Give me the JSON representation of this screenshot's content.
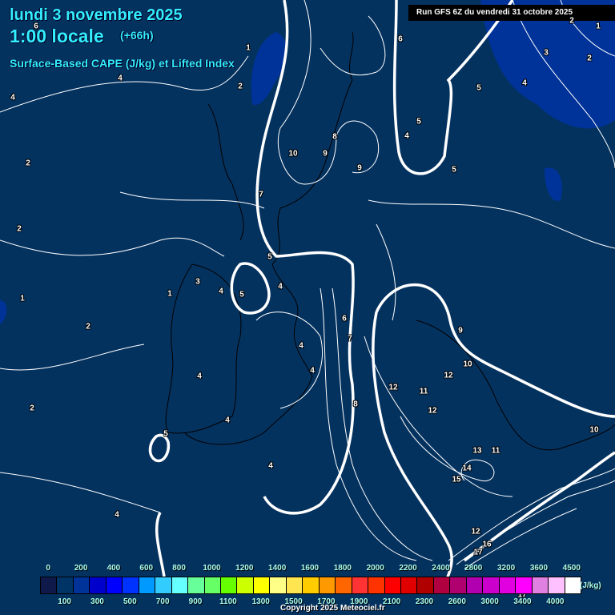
{
  "header": {
    "date": "lundi 3 novembre 2025",
    "time": "1:00 locale",
    "lead": "(+66h)",
    "subtitle": "Surface-Based CAPE (J/kg) et Lifted Index",
    "run": "Run GFS 6Z du vendredi 31 octobre 2025"
  },
  "map": {
    "contour_labels": [
      "6",
      "1",
      "4",
      "4",
      "2",
      "2",
      "2",
      "2",
      "1",
      "2",
      "2",
      "1",
      "3",
      "4",
      "5",
      "4",
      "4",
      "4",
      "5",
      "4",
      "4",
      "7",
      "5",
      "10",
      "9",
      "8",
      "9",
      "6",
      "5",
      "5",
      "4",
      "5",
      "3",
      "4",
      "2",
      "1",
      "2",
      "6",
      "7",
      "4",
      "4",
      "8",
      "9",
      "10",
      "12",
      "12",
      "11",
      "12",
      "13",
      "11",
      "14",
      "15",
      "10",
      "12",
      "16",
      "17",
      "17"
    ]
  },
  "legend": {
    "colors": [
      "#0f1a4a",
      "#003366",
      "#003399",
      "#0000cc",
      "#0000ff",
      "#0033ff",
      "#0099ff",
      "#33ccff",
      "#66ffff",
      "#66ff99",
      "#66ff66",
      "#66ff00",
      "#ccff00",
      "#ffff00",
      "#ffff88",
      "#ffe650",
      "#ffcc00",
      "#ff9900",
      "#ff6600",
      "#ff3333",
      "#ff3300",
      "#ff0000",
      "#e00000",
      "#b00000",
      "#b00040",
      "#b00070",
      "#b000b0",
      "#cc00cc",
      "#e000e0",
      "#ff00ff",
      "#e080e0",
      "#ffc0ff",
      "#ffffff"
    ],
    "top_labels": [
      "0",
      "200",
      "400",
      "600",
      "800",
      "1000",
      "1200",
      "1400",
      "1600",
      "1800",
      "2000",
      "2200",
      "2400",
      "2800",
      "3200",
      "3600",
      "4500"
    ],
    "bottom_labels": [
      "100",
      "300",
      "500",
      "700",
      "900",
      "1100",
      "1300",
      "1500",
      "1700",
      "1900",
      "2100",
      "2300",
      "2600",
      "3000",
      "3400",
      "4000"
    ],
    "unit": "(J/kg)"
  },
  "copyright": "Copyright 2025 Meteociel.fr"
}
